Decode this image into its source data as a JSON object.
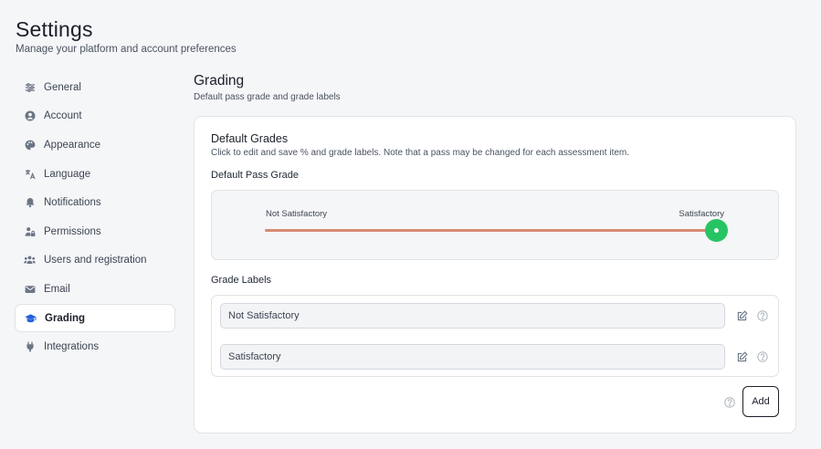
{
  "page": {
    "title": "Settings",
    "subtitle": "Manage your platform and account preferences"
  },
  "sidebar": {
    "items": [
      {
        "label": "General",
        "icon": "sliders-icon"
      },
      {
        "label": "Account",
        "icon": "user-circle-icon"
      },
      {
        "label": "Appearance",
        "icon": "palette-icon"
      },
      {
        "label": "Language",
        "icon": "translate-icon"
      },
      {
        "label": "Notifications",
        "icon": "bell-icon"
      },
      {
        "label": "Permissions",
        "icon": "user-lock-icon"
      },
      {
        "label": "Users and registration",
        "icon": "users-icon"
      },
      {
        "label": "Email",
        "icon": "envelope-icon"
      },
      {
        "label": "Grading",
        "icon": "graduation-cap-icon",
        "active": true
      },
      {
        "label": "Integrations",
        "icon": "plug-icon"
      }
    ],
    "active_color": "#2360d8"
  },
  "section": {
    "title": "Grading",
    "subtitle": "Default pass grade and grade labels"
  },
  "card": {
    "title": "Default Grades",
    "description": "Click to edit and save % and grade labels. Note that a pass may be changed for each assessment item.",
    "pass_grade_label": "Default Pass Grade",
    "slider": {
      "left_label": "Not Satisfactory",
      "right_label": "Satisfactory",
      "value_fraction": 1.0,
      "track_color": "#d68a76",
      "handle_color": "#27c464"
    },
    "grade_labels_title": "Grade Labels",
    "grade_labels": [
      {
        "value": "Not Satisfactory"
      },
      {
        "value": "Satisfactory"
      }
    ],
    "add_label": "Add"
  }
}
